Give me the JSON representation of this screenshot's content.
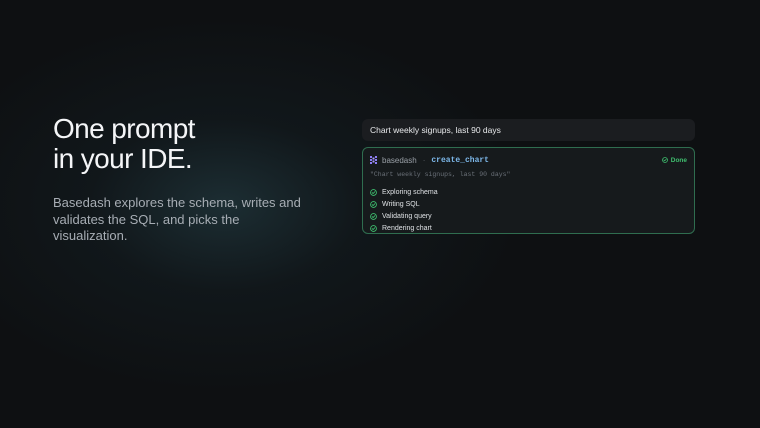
{
  "hero": {
    "headline_line1": "One prompt",
    "headline_line2": "in your IDE.",
    "subtext": "Basedash explores the schema, writes and validates the SQL, and picks the visualization."
  },
  "prompt": {
    "text": "Chart weekly signups, last 90 days"
  },
  "tool_call": {
    "source": "basedash",
    "separator": "·",
    "name": "create_chart",
    "status": "Done",
    "args": "\"Chart weekly signups, last 90 days\"",
    "steps": [
      {
        "label": "Exploring schema"
      },
      {
        "label": "Writing SQL"
      },
      {
        "label": "Validating query"
      },
      {
        "label": "Rendering chart"
      }
    ]
  },
  "icons": {
    "logo": "basedash-logo-icon",
    "done": "check-circle-icon",
    "step": "check-circle-icon"
  },
  "colors": {
    "background": "#0e1012",
    "accent_green": "#3fbf6f",
    "card_border": "#2f6d4f",
    "tool_name": "#7db8ea",
    "logo_purple": "#8b7cf6"
  }
}
